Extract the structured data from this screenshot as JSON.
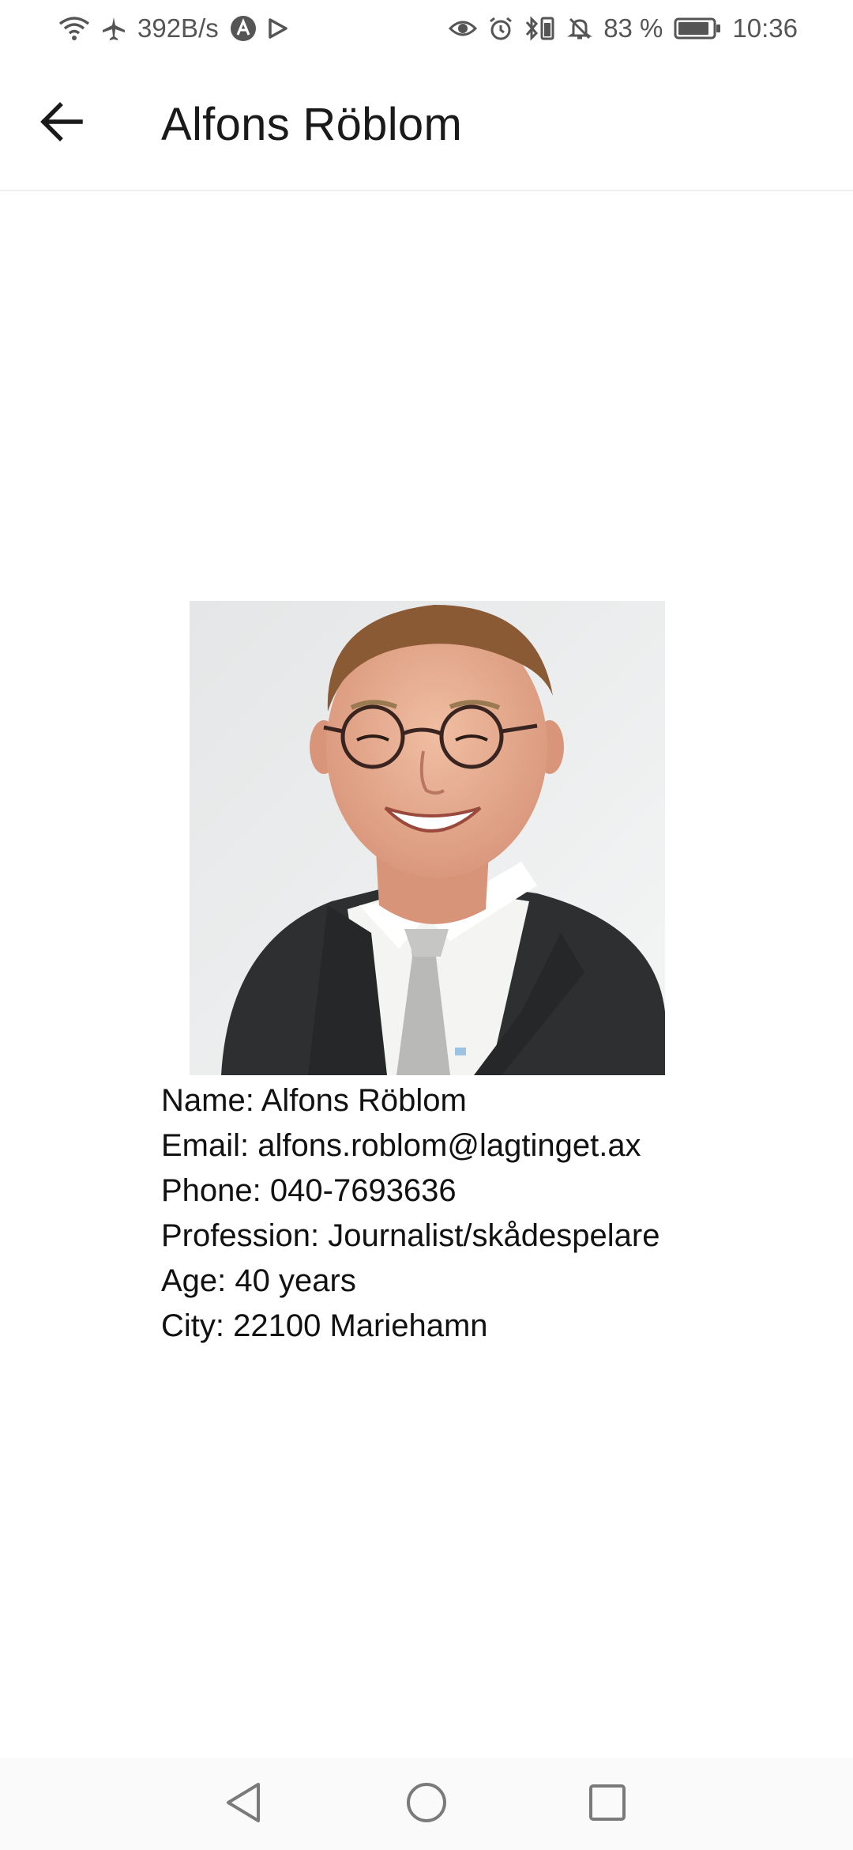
{
  "status_bar": {
    "speed": "392B/s",
    "battery_percent": "83 %",
    "time": "10:36",
    "icons": [
      "wifi-icon",
      "airplane-icon",
      "app-notification-icon",
      "play-icon",
      "eye-icon",
      "alarm-icon",
      "bluetooth-icon",
      "silent-icon",
      "battery-icon"
    ]
  },
  "app_bar": {
    "title": "Alfons Röblom",
    "back_icon": "arrow-left-icon"
  },
  "profile": {
    "name_row": "Name: Alfons Röblom",
    "email_row": "Email: alfons.roblom@lagtinget.ax",
    "phone_row": "Phone: 040-7693636",
    "profession_row": "Profession: Journalist/skådespelare",
    "age_row": "Age: 40 years",
    "city_row": "City: 22100 Mariehamn"
  },
  "nav_bar": {
    "icons": [
      "back-triangle-icon",
      "home-circle-icon",
      "recents-square-icon"
    ]
  },
  "colors": {
    "background": "#ffffff",
    "text": "#1a1a1a",
    "status_text": "#555555",
    "suit": "#2e2f30",
    "shirt": "#f4f4f2",
    "tie": "#b9b9b7",
    "skin": "#e6ae92",
    "hair": "#8a5a34"
  }
}
